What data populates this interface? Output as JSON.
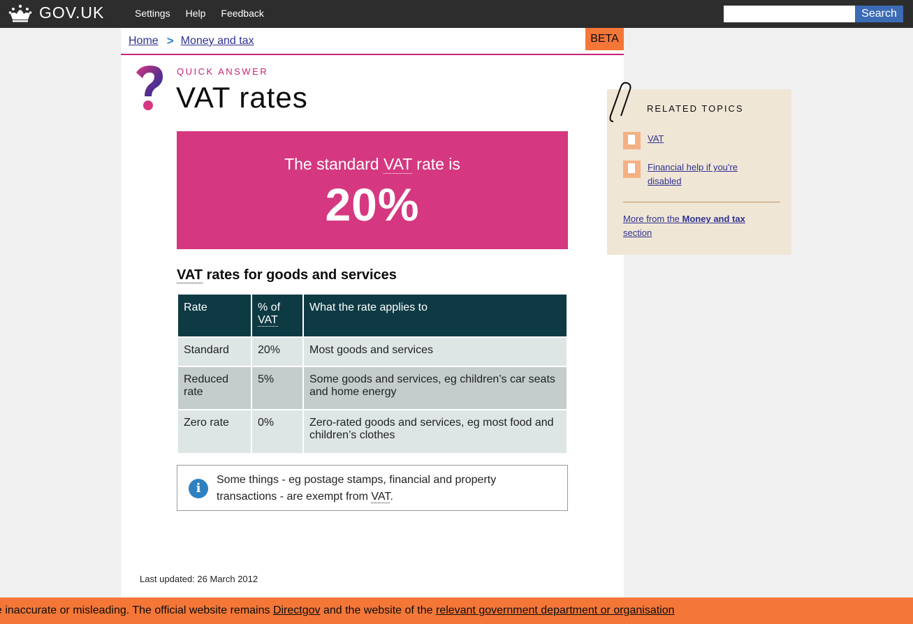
{
  "header": {
    "logo_text": "GOV.UK",
    "nav": [
      "Settings",
      "Help",
      "Feedback"
    ],
    "search_placeholder": "",
    "search_label": "Search"
  },
  "breadcrumb": [
    "Home",
    "Money and tax"
  ],
  "beta_label": "BETA",
  "page": {
    "kicker": "QUICK ANSWER",
    "title": "VAT rates"
  },
  "hero": {
    "pre": "The standard ",
    "abbr": "VAT",
    "post": " rate is",
    "value": "20%"
  },
  "section": {
    "abbr": "VAT",
    "title_rest": " rates for goods and services"
  },
  "table": {
    "headers": [
      "Rate",
      "% of",
      "VAT",
      "What the rate applies to"
    ],
    "rows": [
      [
        "Standard",
        "20%",
        "Most goods and services"
      ],
      [
        "Reduced rate",
        "5%",
        "Some goods and services, eg children’s car seats and home energy"
      ],
      [
        "Zero rate",
        "0%",
        "Zero-rated goods and services, eg most food and children’s clothes"
      ]
    ]
  },
  "note": {
    "icon": "info-icon",
    "text": "Some things - eg postage stamps, financial and property transactions - are exempt from ",
    "abbr": "VAT",
    "end": "."
  },
  "last_updated": "Last updated: 26 March 2012",
  "related": {
    "title": "RELATED TOPICS",
    "items": [
      "VAT",
      "Financial help if you're disabled"
    ],
    "more_pre": "More from the ",
    "more_bold": "Money and tax",
    "more_post": " section"
  },
  "banner": {
    "text1": "e inaccurate or misleading. The official website remains ",
    "link1": "Directgov",
    "text2": " and the website of the ",
    "link2": "relevant government department or organisation"
  },
  "colors": {
    "topbar": "#2d2d2d",
    "hero": "#d53880",
    "accent_pink": "#c42377",
    "table_header": "#0e3a44",
    "beta": "#f47738",
    "search_button": "#3b6bb5",
    "related_bg": "#f0e6d6"
  }
}
